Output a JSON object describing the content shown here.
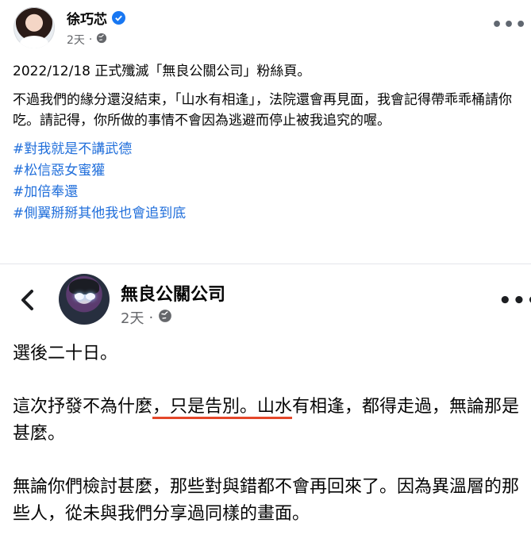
{
  "post": {
    "author": "徐巧芯",
    "verified": true,
    "time": "2天",
    "privacy_icon": "globe-icon",
    "more_icon": "more-options-icon",
    "paragraphs": [
      "2022/12/18 正式殲滅「無良公關公司」粉絲頁。",
      "不過我們的緣分還沒結束，「山水有相逢」，法院還會再見面，我會記得帶乖乖桶請你吃。請記得，你所做的事情不會因為逃避而停止被我追究的喔。"
    ],
    "hashtags": [
      "#對我就是不講武德",
      "#松信惡女蜜獾",
      "#加倍奉還",
      "#側翼掰掰其他我也會追到底"
    ]
  },
  "screenshot": {
    "back_icon": "back-arrow-icon",
    "author": "無良公關公司",
    "time": "2天",
    "privacy_icon": "globe-icon",
    "more_icon": "more-options-icon",
    "line1": "選後二十日。",
    "p2_before": "這次抒發不為什麼",
    "p2_underlined": "，只是告別。山水",
    "p2_after": "有相逢，都得走過，無論那是甚麼。",
    "p3": "無論你們檢討甚麼，那些對與錯都不會再回來了。因為異溫層的那些人，從未與我們分享過同樣的畫面。"
  },
  "colors": {
    "hashtag": "#216fdb",
    "verified": "#1877f2",
    "underline": "#e4472a"
  }
}
